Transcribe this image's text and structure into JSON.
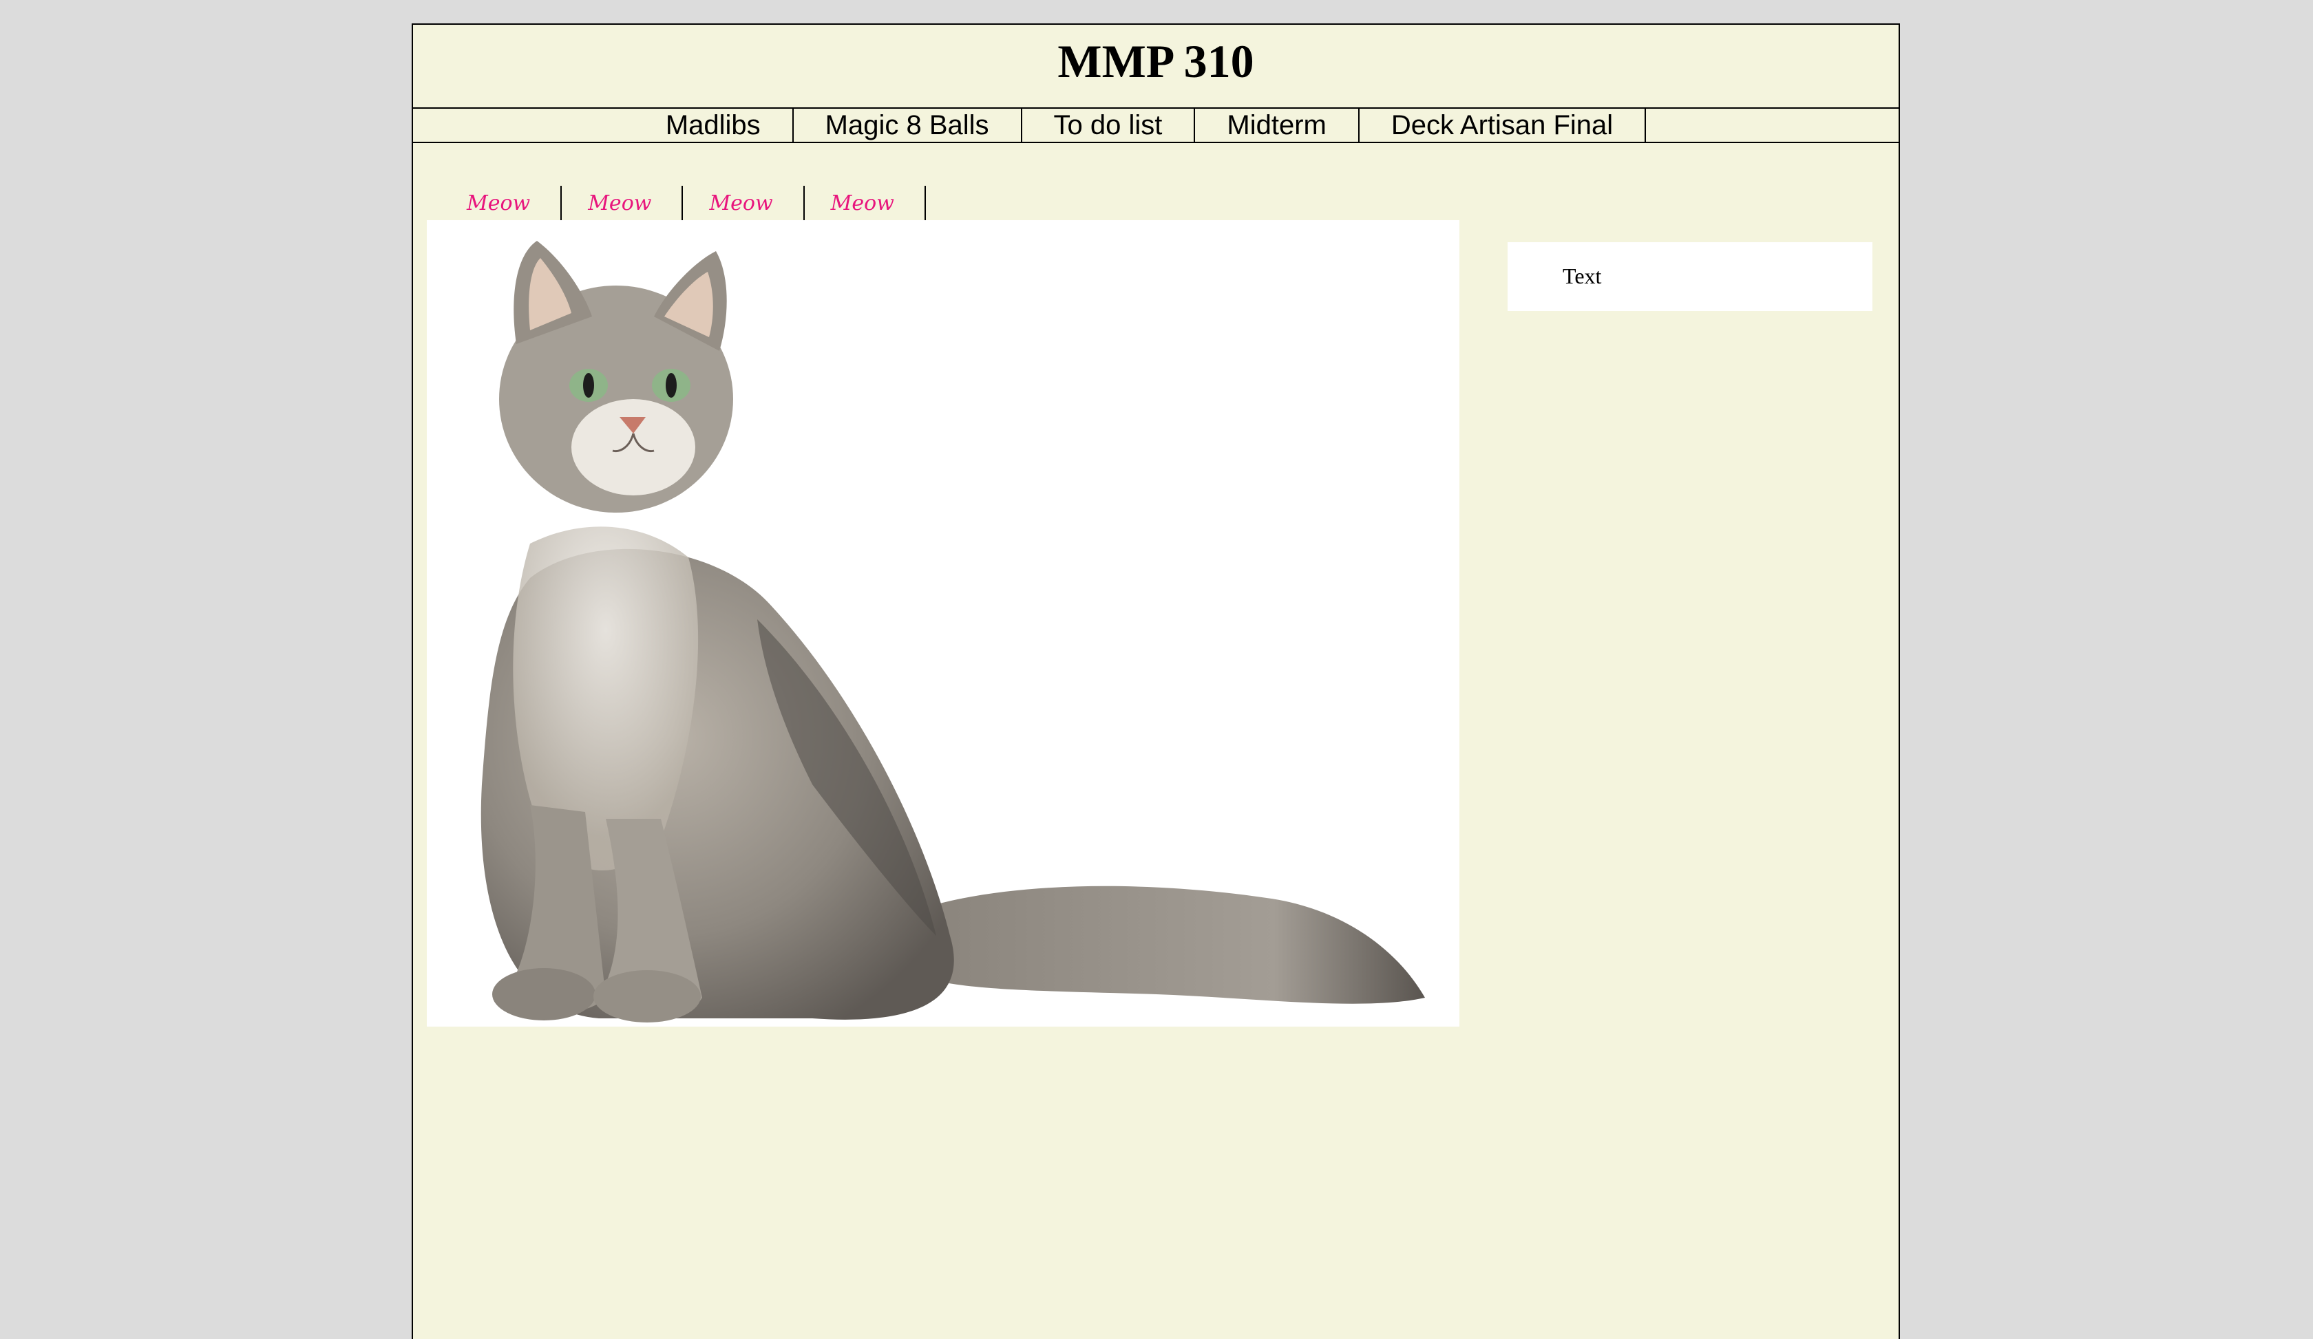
{
  "header": {
    "title": "MMP 310"
  },
  "main_nav": {
    "items": [
      {
        "label": "Madlibs"
      },
      {
        "label": "Magic 8 Balls"
      },
      {
        "label": "To do list"
      },
      {
        "label": "Midterm"
      },
      {
        "label": "Deck Artisan Final"
      }
    ]
  },
  "sub_nav": {
    "items": [
      {
        "label": "Meow"
      },
      {
        "label": "Meow"
      },
      {
        "label": "Meow"
      },
      {
        "label": "Meow"
      }
    ],
    "color": "#e8157d"
  },
  "hero": {
    "image": "cat-photo"
  },
  "sidebar": {
    "text": "Text"
  },
  "colors": {
    "page_background": "#f4f4dd",
    "outer_background": "#dcdcdc",
    "panel": "#ffffff"
  }
}
